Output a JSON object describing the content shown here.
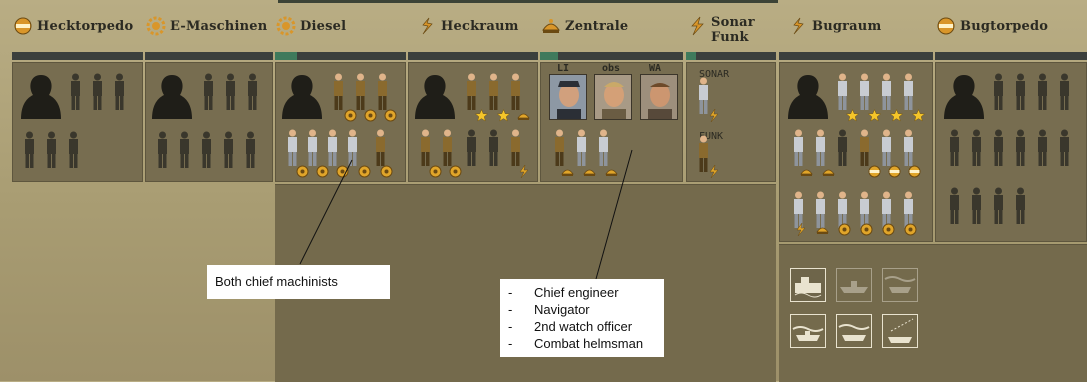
{
  "compartments": [
    {
      "id": "hecktorpedo",
      "label": "Hecktorpedo",
      "icon": "torpedo-icon"
    },
    {
      "id": "e-maschinen",
      "label": "E-Maschinen",
      "icon": "gear-icon"
    },
    {
      "id": "diesel",
      "label": "Diesel",
      "icon": "gear-icon"
    },
    {
      "id": "heckraum",
      "label": "Heckraum",
      "icon": "helm-icon"
    },
    {
      "id": "zentrale",
      "label": "Zentrale",
      "icon": "anchor-icon"
    },
    {
      "id": "sonar-funk",
      "label": "Sonar\nFunk",
      "icon": "lightning-icon"
    },
    {
      "id": "bugraum",
      "label": "Bugraum",
      "icon": "helm-icon"
    },
    {
      "id": "bugtorpedo",
      "label": "Bugtorpedo",
      "icon": "torpedo-icon"
    }
  ],
  "officers": [
    {
      "label": "LI",
      "role": "Chief engineer"
    },
    {
      "label": "obs",
      "role": "Navigator"
    },
    {
      "label": "WA",
      "role": "2nd watch officer"
    }
  ],
  "sonar_labels": {
    "sonar": "SONAR",
    "funk": "FUNK"
  },
  "annotations": {
    "machinists_note": "Both chief machinists",
    "zentrale_note": [
      "Chief engineer",
      "Navigator",
      "2nd watch officer",
      "Combat helmsman"
    ]
  },
  "colors": {
    "accent_bar": "#3f7a5c",
    "panel": "#776d50",
    "background": "#ada177",
    "badge_gold": "#e0a52a",
    "star": "#f4c52a"
  }
}
